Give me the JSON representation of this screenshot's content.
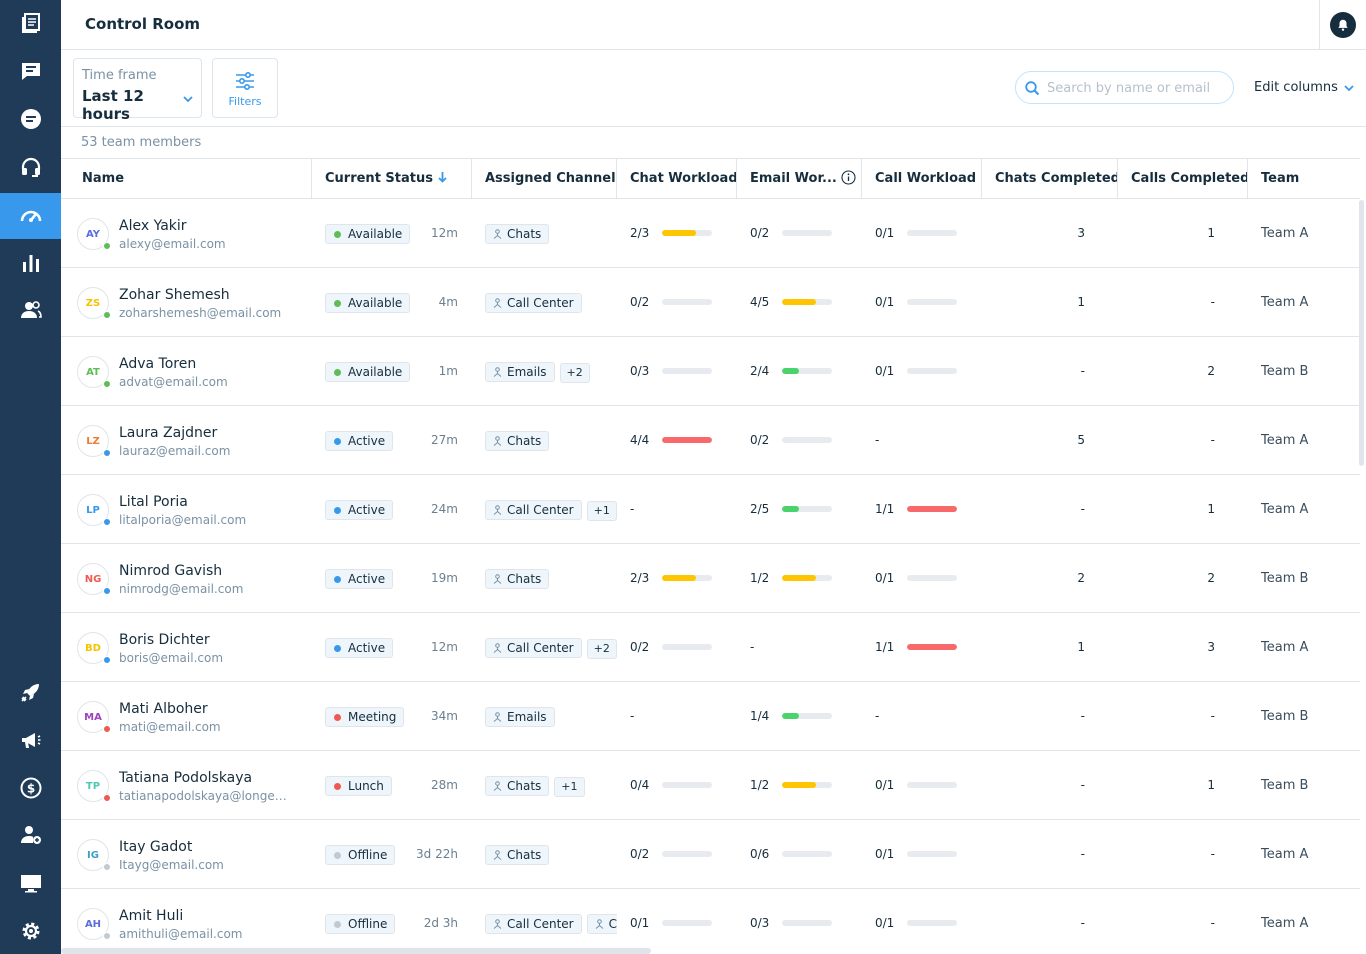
{
  "header": {
    "title": "Control Room"
  },
  "toolbar": {
    "timeframe_label": "Time frame",
    "timeframe_value": "Last 12 hours",
    "filters_label": "Filters",
    "search_placeholder": "Search by name or email",
    "edit_columns": "Edit columns"
  },
  "members_count": "53 team members",
  "colors": {
    "sidebar": "#1f3b57",
    "accent": "#3899ec",
    "available": "#60bc57",
    "active": "#3899ec",
    "busy": "#ee5951",
    "offline": "#c1c9d1",
    "bar_yellow": "#fdc600",
    "bar_red": "#f86a6a",
    "bar_green": "#4bd36b"
  },
  "columns": [
    "Name",
    "Current Status",
    "Assigned Channels",
    "Chat Workload",
    "Email Wor...",
    "Call Workload",
    "Chats Completed",
    "Calls Completed",
    "Team"
  ],
  "rows": [
    {
      "initials": "AY",
      "initials_color": "#5b6ee0",
      "name": "Alex Yakir",
      "email": "alexy@email.com",
      "presence": "available",
      "status": "Available",
      "status_time": "12m",
      "channels": [
        "Chats"
      ],
      "extra": "",
      "chat": "2/3",
      "chat_fill": 0.67,
      "chat_color": "yellow",
      "email_wl": "0/2",
      "email_fill": 0,
      "email_color": "",
      "call": "0/1",
      "call_fill": 0,
      "call_color": "",
      "chats_completed": "3",
      "calls_completed": "1",
      "team": "Team A"
    },
    {
      "initials": "ZS",
      "initials_color": "#f3c300",
      "name": "Zohar Shemesh",
      "email": "zoharshemesh@email.com",
      "presence": "available",
      "status": "Available",
      "status_time": "4m",
      "channels": [
        "Call Center"
      ],
      "extra": "",
      "chat": "0/2",
      "chat_fill": 0,
      "chat_color": "",
      "email_wl": "4/5",
      "email_fill": 0.67,
      "email_color": "yellow",
      "call": "0/1",
      "call_fill": 0,
      "call_color": "",
      "chats_completed": "1",
      "calls_completed": "-",
      "team": "Team A"
    },
    {
      "initials": "AT",
      "initials_color": "#60bc57",
      "name": "Adva Toren",
      "email": "advat@email.com",
      "presence": "available",
      "status": "Available",
      "status_time": "1m",
      "channels": [
        "Emails"
      ],
      "extra": "+2",
      "chat": "0/3",
      "chat_fill": 0,
      "chat_color": "",
      "email_wl": "2/4",
      "email_fill": 0.33,
      "email_color": "green",
      "call": "0/1",
      "call_fill": 0,
      "call_color": "",
      "chats_completed": "-",
      "calls_completed": "2",
      "team": "Team B"
    },
    {
      "initials": "LZ",
      "initials_color": "#f07b2e",
      "name": "Laura Zajdner",
      "email": "lauraz@email.com",
      "presence": "active",
      "status": "Active",
      "status_time": "27m",
      "channels": [
        "Chats"
      ],
      "extra": "",
      "chat": "4/4",
      "chat_fill": 1,
      "chat_color": "red",
      "email_wl": "0/2",
      "email_fill": 0,
      "email_color": "",
      "call": "-",
      "call_fill": null,
      "call_color": "",
      "chats_completed": "5",
      "calls_completed": "-",
      "team": "Team A"
    },
    {
      "initials": "LP",
      "initials_color": "#3899ec",
      "name": "Lital Poria",
      "email": "litalporia@email.com",
      "presence": "active",
      "status": "Active",
      "status_time": "24m",
      "channels": [
        "Call Center"
      ],
      "extra": "+1",
      "chat": "-",
      "chat_fill": null,
      "chat_color": "",
      "email_wl": "2/5",
      "email_fill": 0.33,
      "email_color": "green",
      "call": "1/1",
      "call_fill": 1,
      "call_color": "red",
      "chats_completed": "-",
      "calls_completed": "1",
      "team": "Team A"
    },
    {
      "initials": "NG",
      "initials_color": "#ee5951",
      "name": "Nimrod Gavish",
      "email": "nimrodg@email.com",
      "presence": "active",
      "status": "Active",
      "status_time": "19m",
      "channels": [
        "Chats"
      ],
      "extra": "",
      "chat": "2/3",
      "chat_fill": 0.67,
      "chat_color": "yellow",
      "email_wl": "1/2",
      "email_fill": 0.67,
      "email_color": "yellow",
      "call": "0/1",
      "call_fill": 0,
      "call_color": "",
      "chats_completed": "2",
      "calls_completed": "2",
      "team": "Team B"
    },
    {
      "initials": "BD",
      "initials_color": "#f3c300",
      "name": "Boris Dichter",
      "email": "boris@email.com",
      "presence": "active",
      "status": "Active",
      "status_time": "12m",
      "channels": [
        "Call Center"
      ],
      "extra": "+2",
      "chat": "0/2",
      "chat_fill": 0,
      "chat_color": "",
      "email_wl": "-",
      "email_fill": null,
      "email_color": "",
      "call": "1/1",
      "call_fill": 1,
      "call_color": "red",
      "chats_completed": "1",
      "calls_completed": "3",
      "team": "Team A"
    },
    {
      "initials": "MA",
      "initials_color": "#a040c0",
      "name": "Mati Alboher",
      "email": "mati@email.com",
      "presence": "busy",
      "status": "Meeting",
      "status_time": "34m",
      "channels": [
        "Emails"
      ],
      "extra": "",
      "chat": "-",
      "chat_fill": null,
      "chat_color": "",
      "email_wl": "1/4",
      "email_fill": 0.33,
      "email_color": "green",
      "call": "-",
      "call_fill": null,
      "call_color": "",
      "chats_completed": "-",
      "calls_completed": "-",
      "team": "Team B"
    },
    {
      "initials": "TP",
      "initials_color": "#4ec9b0",
      "name": "Tatiana Podolskaya",
      "email": "tatianapodolskaya@longemai...",
      "presence": "busy",
      "status": "Lunch",
      "status_time": "28m",
      "channels": [
        "Chats"
      ],
      "extra": "+1",
      "chat": "0/4",
      "chat_fill": 0,
      "chat_color": "",
      "email_wl": "1/2",
      "email_fill": 0.67,
      "email_color": "yellow",
      "call": "0/1",
      "call_fill": 0,
      "call_color": "",
      "chats_completed": "-",
      "calls_completed": "1",
      "team": "Team B"
    },
    {
      "initials": "IG",
      "initials_color": "#3aa0c8",
      "name": "Itay Gadot",
      "email": "Itayg@email.com",
      "presence": "offline",
      "status": "Offline",
      "status_time": "3d 22h",
      "channels": [
        "Chats"
      ],
      "extra": "",
      "chat": "0/2",
      "chat_fill": 0,
      "chat_color": "",
      "email_wl": "0/6",
      "email_fill": 0,
      "email_color": "",
      "call": "0/1",
      "call_fill": 0,
      "call_color": "",
      "chats_completed": "-",
      "calls_completed": "-",
      "team": "Team A"
    },
    {
      "initials": "AH",
      "initials_color": "#5b6ee0",
      "name": "Amit Huli",
      "email": "amithuli@email.com",
      "presence": "offline",
      "status": "Offline",
      "status_time": "2d 3h",
      "channels": [
        "Call Center",
        "Cha"
      ],
      "extra": "",
      "chat": "0/1",
      "chat_fill": 0,
      "chat_color": "",
      "email_wl": "0/3",
      "email_fill": 0,
      "email_color": "",
      "call": "0/1",
      "call_fill": 0,
      "call_color": "",
      "chats_completed": "-",
      "calls_completed": "-",
      "team": "Team A"
    }
  ],
  "sidebar_icons": [
    "book-icon",
    "message-square-icon",
    "chat-bubble-icon",
    "headset-icon",
    "gauge-icon",
    "bar-chart-icon",
    "users-icon",
    "rocket-icon",
    "megaphone-icon",
    "dollar-icon",
    "add-user-icon",
    "monitor-icon",
    "gear-icon"
  ]
}
